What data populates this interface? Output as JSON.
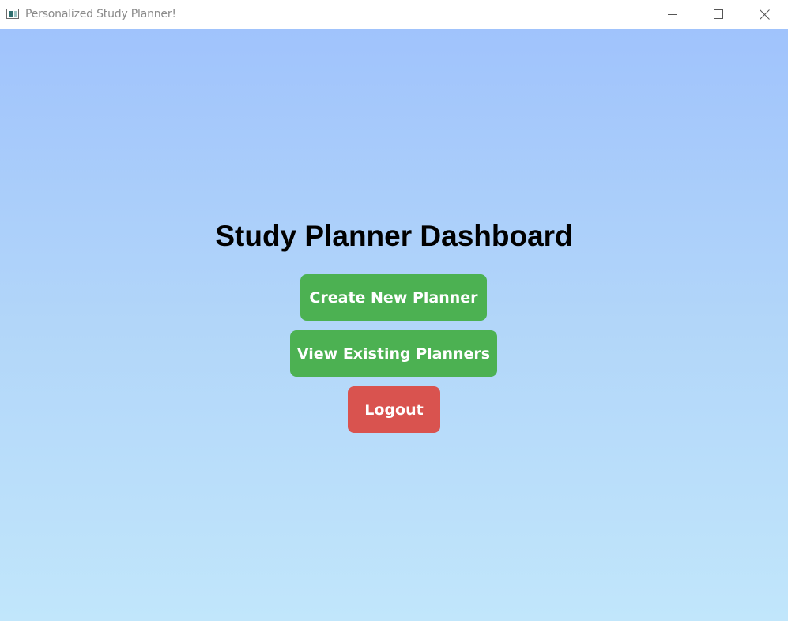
{
  "window": {
    "title": "Personalized Study Planner!",
    "controls": {
      "minimize_icon": "minimize-icon",
      "maximize_icon": "maximize-icon",
      "close_icon": "close-icon"
    }
  },
  "dashboard": {
    "heading": "Study Planner Dashboard",
    "buttons": {
      "create": "Create New Planner",
      "view": "View Existing Planners",
      "logout": "Logout"
    }
  },
  "colors": {
    "primary_button": "#4cb152",
    "danger_button": "#d9534f",
    "background_top": "#a0c3fc",
    "background_bottom": "#c1e6fb"
  }
}
